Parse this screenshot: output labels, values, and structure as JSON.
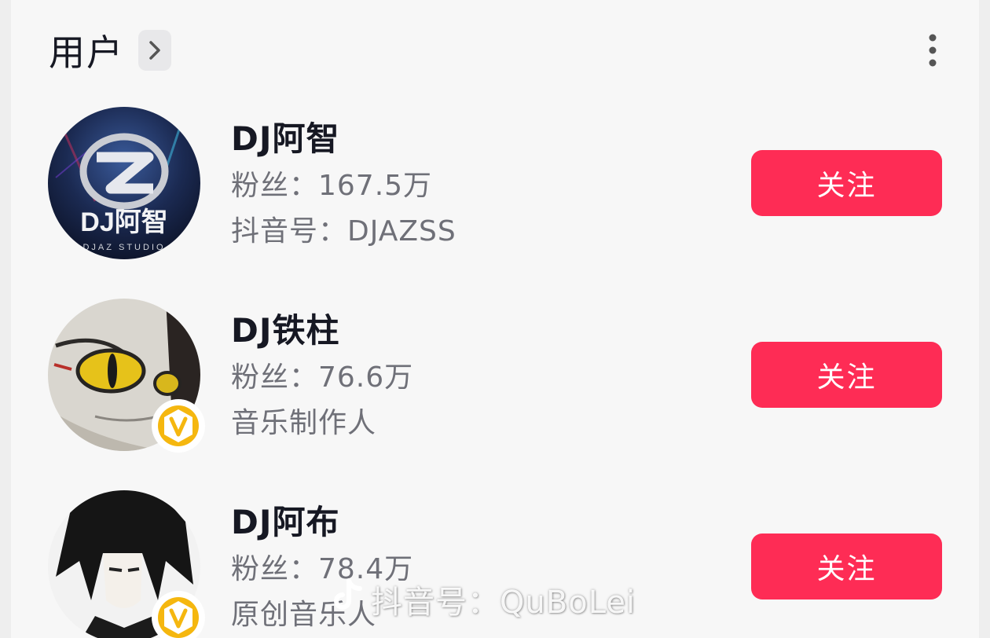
{
  "section": {
    "title": "用户",
    "more_icon": "more-vertical-icon",
    "chevron_icon": "chevron-right-icon"
  },
  "users": [
    {
      "name": "DJ阿智",
      "fans": "粉丝：167.5万",
      "subtitle": "抖音号：DJAZSS",
      "avatar_text": "DJ阿智",
      "avatar_subtext": "DJAZ STUDIO",
      "verified": false,
      "follow_label": "关注"
    },
    {
      "name": "DJ铁柱",
      "fans": "粉丝：76.6万",
      "subtitle": "音乐制作人",
      "verified": true,
      "follow_label": "关注"
    },
    {
      "name": "DJ阿布",
      "fans": "粉丝：78.4万",
      "subtitle": "原创音乐人",
      "verified": true,
      "follow_label": "关注"
    }
  ],
  "watermark": {
    "text": "抖音号：QuBoLei",
    "icon": "tiktok-logo-icon"
  },
  "colors": {
    "follow_button": "#fe2c55",
    "name_text": "#161823",
    "meta_text": "#6f7078",
    "verified_badge": "#f5b70f"
  }
}
